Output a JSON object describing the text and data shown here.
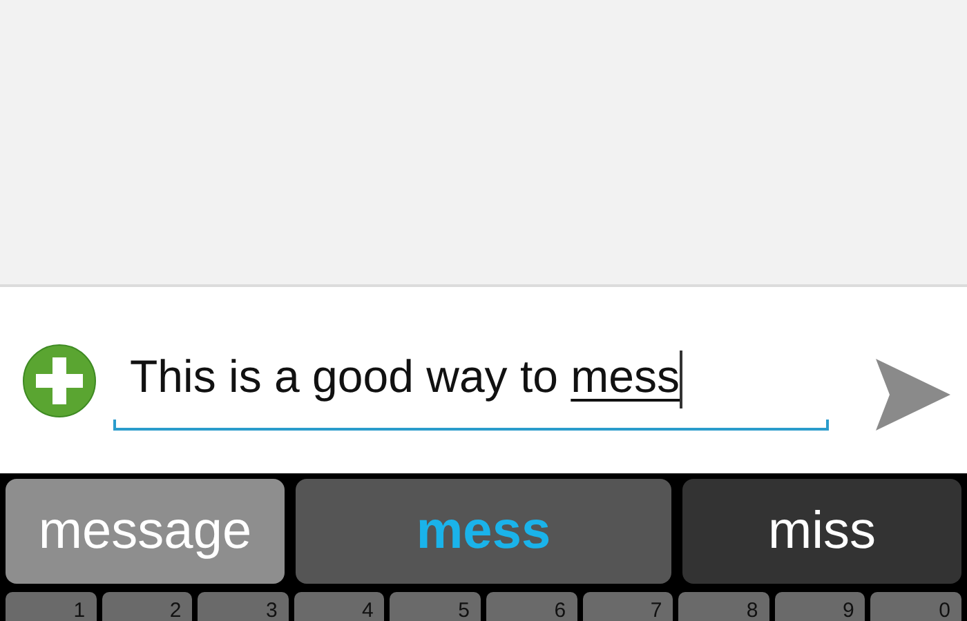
{
  "composer": {
    "text": "This is a good way to ",
    "composing": "mess"
  },
  "suggestions": [
    {
      "word": "message",
      "selected": false,
      "pressed": true
    },
    {
      "word": "mess",
      "selected": true,
      "pressed": false
    },
    {
      "word": "miss",
      "selected": false,
      "pressed": false
    }
  ],
  "keys": [
    "1",
    "2",
    "3",
    "4",
    "5",
    "6",
    "7",
    "8",
    "9",
    "0"
  ]
}
